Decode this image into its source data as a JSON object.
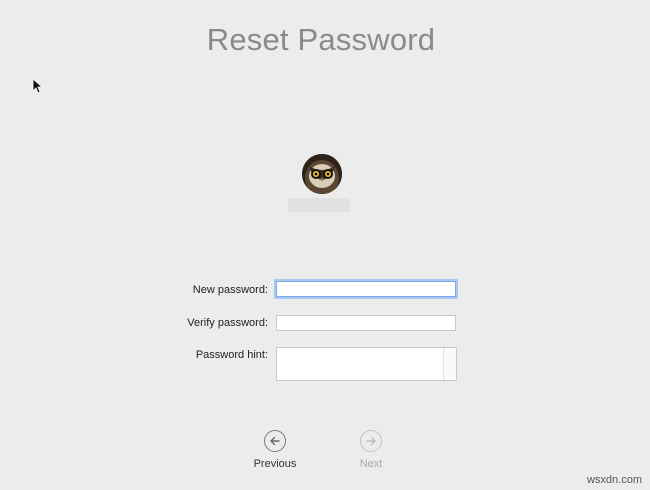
{
  "title": "Reset Password",
  "user": {
    "avatar_icon": "owl-avatar-icon"
  },
  "form": {
    "new_password_label": "New password:",
    "verify_password_label": "Verify password:",
    "password_hint_label": "Password hint:",
    "new_password_value": "",
    "verify_password_value": "",
    "password_hint_value": ""
  },
  "navigation": {
    "previous_label": "Previous",
    "next_label": "Next",
    "next_enabled": false
  },
  "watermark": "wsxdn.com",
  "colors": {
    "background": "#ececec",
    "title": "#8a8a8a",
    "focus_ring": "#a9c8f1",
    "disabled_text": "#a8a8a8"
  }
}
